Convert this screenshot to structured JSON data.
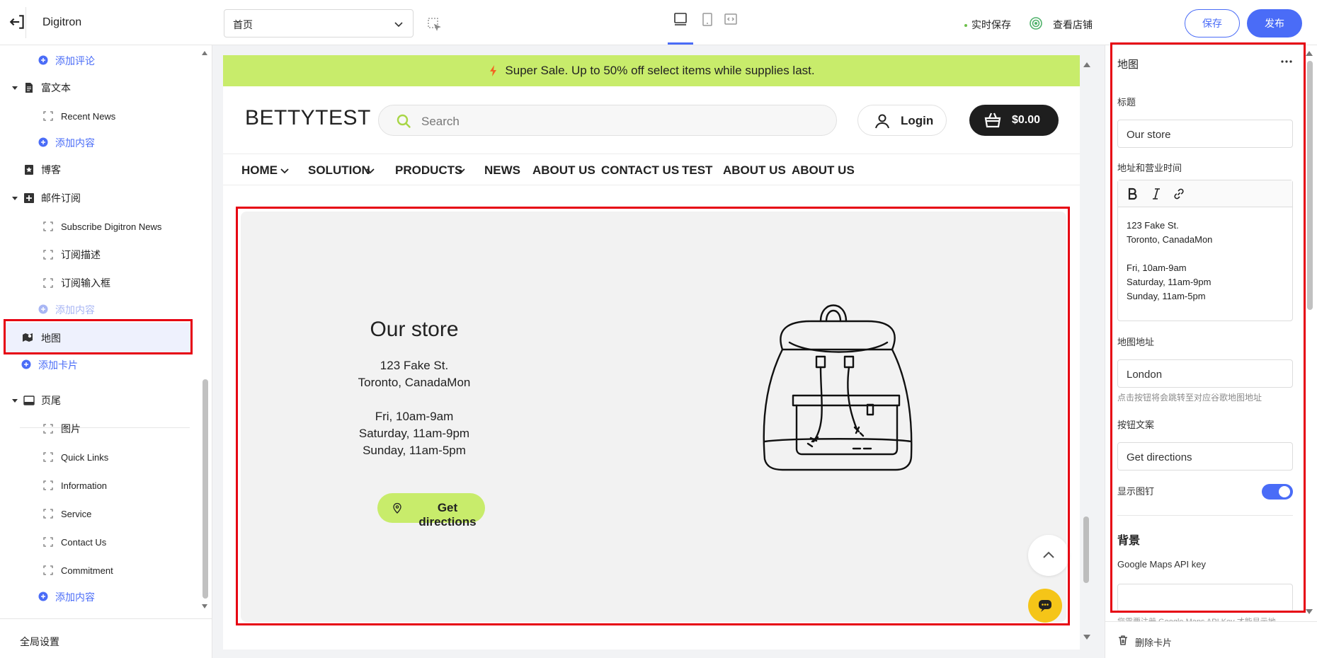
{
  "topbar": {
    "store_name": "Digitron",
    "page_select_value": "首页",
    "autosave_label": "实时保存",
    "view_store_label": "查看店铺",
    "save_label": "保存",
    "publish_label": "发布"
  },
  "sidebar": {
    "items": [
      {
        "label": "添加评论"
      },
      {
        "label": "富文本"
      },
      {
        "label": "Recent News"
      },
      {
        "label": "添加内容"
      },
      {
        "label": "博客"
      },
      {
        "label": "邮件订阅"
      },
      {
        "label": "Subscribe Digitron News"
      },
      {
        "label": "订阅描述"
      },
      {
        "label": "订阅输入框"
      },
      {
        "label": "添加内容"
      },
      {
        "label": "地图"
      },
      {
        "label": "添加卡片"
      },
      {
        "label": "页尾"
      },
      {
        "label": "图片"
      },
      {
        "label": "Quick Links"
      },
      {
        "label": "Information"
      },
      {
        "label": "Service"
      },
      {
        "label": "Contact Us"
      },
      {
        "label": "Commitment"
      },
      {
        "label": "添加内容"
      }
    ],
    "global_settings_label": "全局设置"
  },
  "preview": {
    "announcement": "Super Sale. Up to 50% off select items while supplies last.",
    "logo": "BETTYTEST",
    "search_placeholder": "Search",
    "login_label": "Login",
    "cart_total": "$0.00",
    "nav": [
      "HOME",
      "SOLUTION",
      "PRODUCTS",
      "NEWS",
      "ABOUT US",
      "CONTACT US",
      "TEST",
      "ABOUT US",
      "ABOUT US"
    ],
    "map": {
      "title": "Our store",
      "address": "123 Fake St.\nToronto, CanadaMon\n\nFri, 10am-9am\nSaturday, 11am-9pm\nSunday, 11am-5pm",
      "button": "Get directions"
    }
  },
  "panel": {
    "title": "地图",
    "heading_label": "标题",
    "heading_value": "Our store",
    "address_label": "地址和营业时间",
    "address_value": "123 Fake St.\nToronto, CanadaMon\n\nFri, 10am-9am\nSaturday, 11am-9pm\nSunday, 11am-5pm",
    "map_address_label": "地图地址",
    "map_address_value": "London",
    "map_address_hint": "点击按钮将会跳转至对应谷歌地图地址",
    "button_text_label": "按钮文案",
    "button_text_value": "Get directions",
    "show_pin_label": "显示图钉",
    "show_pin": true,
    "background_section": "背景",
    "api_key_label": "Google Maps API key",
    "api_key_value": "",
    "api_key_hint": "您需要注册 Google Maps API Key 才能显示地",
    "delete_label": "删除卡片"
  },
  "colors": {
    "accent": "#4a6cf7",
    "announcement_bg": "#c8ec6b",
    "highlight": "#e60012",
    "chat_fab": "#f5c518"
  }
}
